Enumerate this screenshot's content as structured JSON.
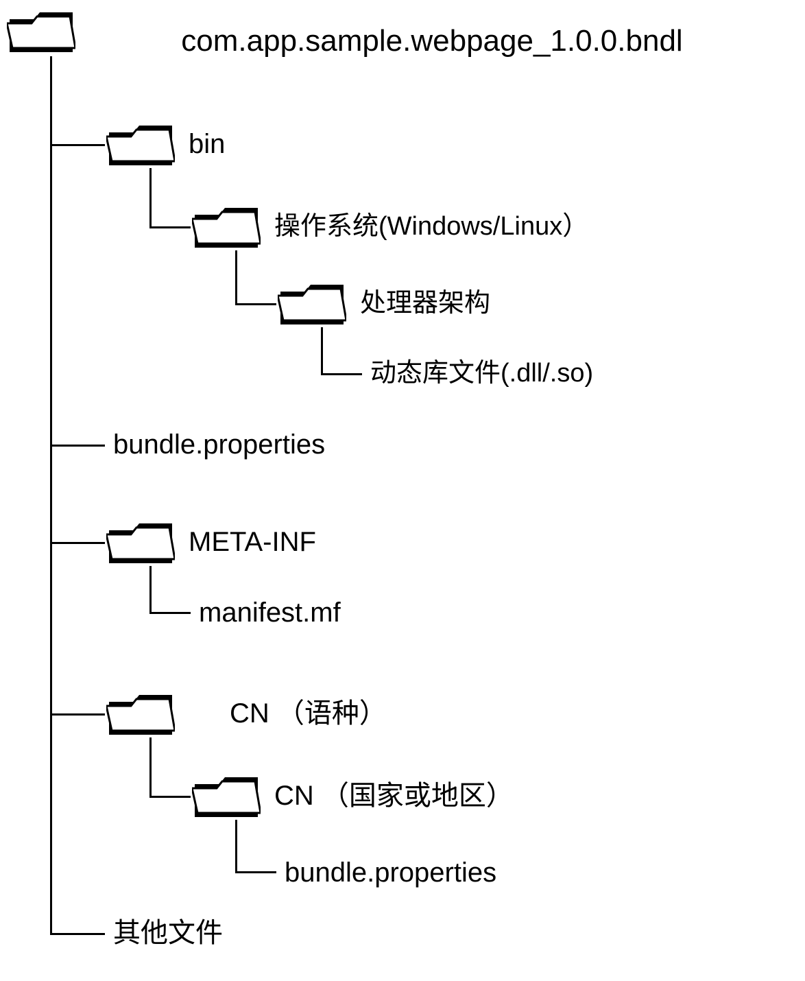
{
  "tree": {
    "root": {
      "label": "com.app.sample.webpage_1.0.0.bndl"
    },
    "bin": {
      "label": "bin"
    },
    "os": {
      "label": "操作系统(Windows/Linux）"
    },
    "arch": {
      "label": "处理器架构"
    },
    "dynlib": {
      "label": "动态库文件(.dll/.so)"
    },
    "bundle_props": {
      "label": "bundle.properties"
    },
    "metainf": {
      "label": "META-INF"
    },
    "manifest": {
      "label": "manifest.mf"
    },
    "cn_lang": {
      "label": "CN （语种）"
    },
    "cn_region": {
      "label": "CN （国家或地区）"
    },
    "bundle_props2": {
      "label": "bundle.properties"
    },
    "other": {
      "label": "其他文件"
    }
  }
}
